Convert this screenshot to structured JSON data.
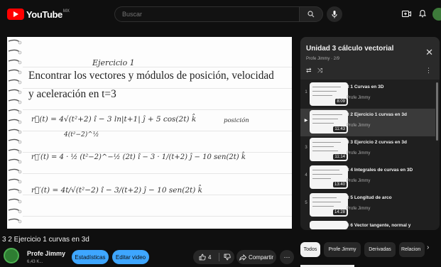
{
  "brand": {
    "logo_text": "YouTube",
    "country": "MX",
    "accent": "#ff0000"
  },
  "search": {
    "placeholder": "Buscar"
  },
  "video": {
    "heading": "Ejercicio 1",
    "problem_line1": "Encontrar los vectores y módulos de posición, velocidad",
    "problem_line2": "y aceleración en t=3",
    "eq1": "r⃗(t) = 4√(t²+2) î − 3 ln|t+1| ĵ + 5 cos(2t) k̂",
    "eq1_label": "posición",
    "eq1_sub": "4(t²−2)^½",
    "eq2": "r⃗′(t) = 4 · ½ (t²−2)^−½ (2t) î − 3 · 1/(t+2) ĵ − 10 sen(2t) k̂",
    "eq3": "r⃗′(t) = 4t/√(t²−2) î − 3/(t+2) ĵ − 10 sen(2t) k̂"
  },
  "below_video": {
    "title": "3 2 Ejercicio 1 curvas en 3d",
    "channel": "Profe Jimmy",
    "subscribers": "6,43 K...",
    "stats_label": "Estadísticas",
    "edit_label": "Editar video",
    "likes": "4",
    "share_label": "Compartir",
    "more_label": "···"
  },
  "playlist": {
    "title": "Unidad 3 cálculo vectorial",
    "subtitle": "Profe Jimmy · 2/9",
    "close": "✕",
    "loop": "⇄",
    "shuffle": "⤨",
    "menu": "⋮",
    "items": [
      {
        "index": "1",
        "title": "3 1 Curvas en 3D",
        "channel": "Profe Jimmy",
        "duration": "8:09"
      },
      {
        "index": "▶",
        "title": "3 2 Ejercicio 1 curvas en 3d",
        "channel": "Profe Jimmy",
        "duration": "11:43"
      },
      {
        "index": "3",
        "title": "3 3 Ejercicio 2 curvas en 3d",
        "channel": "Profe Jimmy",
        "duration": "11:14"
      },
      {
        "index": "4",
        "title": "3 4 Integrales de curvas en 3D",
        "channel": "Profe Jimmy",
        "duration": "13:40"
      },
      {
        "index": "5",
        "title": "3 5 Longitud de arco",
        "channel": "Profe Jimmy",
        "duration": "14:28"
      },
      {
        "index": "",
        "title": "3 6 Vector tangente, normal y",
        "channel": "",
        "duration": ""
      }
    ]
  },
  "chips": [
    "Todos",
    "Profe Jimmy",
    "Derivadas",
    "Relacion"
  ],
  "chip_next": "›"
}
